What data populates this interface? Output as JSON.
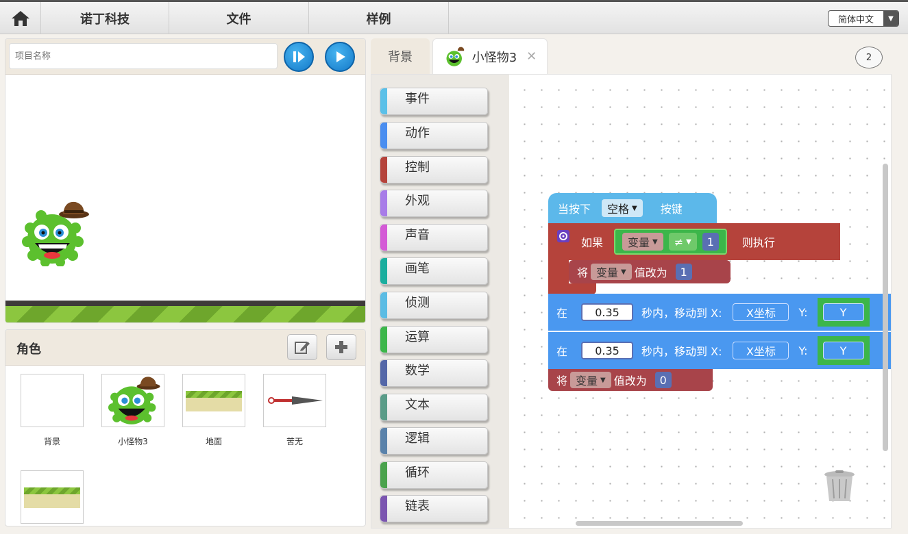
{
  "nav": {
    "menu": [
      "诺丁科技",
      "文件",
      "样例"
    ],
    "language": "简体中文"
  },
  "stage": {
    "project_placeholder": "项目名称"
  },
  "characters": {
    "title": "角色",
    "sprites": [
      {
        "name": "背景"
      },
      {
        "name": "小怪物3"
      },
      {
        "name": "地面"
      },
      {
        "name": "苦无"
      },
      {
        "name": ""
      }
    ]
  },
  "tabs": {
    "background": "背景",
    "sprite": "小怪物3",
    "close": "✕",
    "badge": "2"
  },
  "categories": [
    {
      "label": "事件",
      "color": "#5bc0e8"
    },
    {
      "label": "动作",
      "color": "#4a8ef0"
    },
    {
      "label": "控制",
      "color": "#b5433b"
    },
    {
      "label": "外观",
      "color": "#a87ce8"
    },
    {
      "label": "声音",
      "color": "#d45ad6"
    },
    {
      "label": "画笔",
      "color": "#1aae9e"
    },
    {
      "label": "侦测",
      "color": "#5bbce4"
    },
    {
      "label": "运算",
      "color": "#3cb64a"
    },
    {
      "label": "数学",
      "color": "#5467a8"
    },
    {
      "label": "文本",
      "color": "#5a9c88"
    },
    {
      "label": "逻辑",
      "color": "#5a82aa"
    },
    {
      "label": "循环",
      "color": "#4aa24c"
    },
    {
      "label": "链表",
      "color": "#7b55b0"
    }
  ],
  "script": {
    "hat": {
      "prefix": "当按下",
      "key": "空格",
      "suffix": "按键"
    },
    "if_block": {
      "label": "如果",
      "var": "变量",
      "op": "≠",
      "value": "1",
      "then": "则执行"
    },
    "set1": {
      "label": "将",
      "var": "变量",
      "mid": "值改为",
      "value": "1"
    },
    "move1": {
      "label": "在",
      "time": "0.35",
      "mid": "秒内，移动到 X:",
      "x": "X坐标",
      "ylabel": "Y:",
      "y": "Y"
    },
    "move2": {
      "label": "在",
      "time": "0.35",
      "mid": "秒内，移动到 X:",
      "x": "X坐标",
      "ylabel": "Y:",
      "y": "Y"
    },
    "set2": {
      "label": "将",
      "var": "变量",
      "mid": "值改为",
      "value": "0"
    }
  }
}
